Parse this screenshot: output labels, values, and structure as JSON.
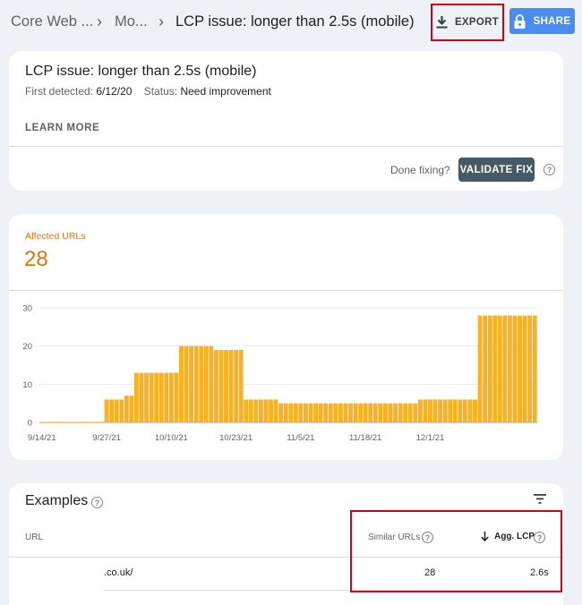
{
  "breadcrumb": {
    "items": [
      "Core Web ...",
      "Mo...",
      "LCP issue: longer than 2.5s (mobile)"
    ]
  },
  "header": {
    "export_label": "EXPORT",
    "share_label": "SHARE",
    "export_icon": "download-icon",
    "share_icon": "lock-icon"
  },
  "issue": {
    "title": "LCP issue: longer than 2.5s (mobile)",
    "first_detected_label": "First detected:",
    "first_detected_value": "6/12/20",
    "status_label": "Status:",
    "status_value": "Need improvement",
    "learn_more": "LEARN MORE",
    "done_fixing": "Done fixing?",
    "validate_fix": "VALIDATE FIX"
  },
  "affected": {
    "label": "Affected URLs",
    "count": "28"
  },
  "chart_data": {
    "type": "bar",
    "series": [
      {
        "values": [
          0,
          0,
          0,
          0,
          0,
          0,
          0,
          0,
          0,
          0,
          0,
          0,
          0,
          6,
          6,
          6,
          6,
          7,
          7,
          13,
          13,
          13,
          13,
          13,
          13,
          13,
          13,
          13,
          20,
          20,
          20,
          20,
          20,
          20,
          20,
          19,
          19,
          19,
          19,
          19,
          19,
          6,
          6,
          6,
          6,
          6,
          6,
          6,
          5,
          5,
          5,
          5,
          5,
          5,
          5,
          5,
          5,
          5,
          5,
          5,
          5,
          5,
          5,
          5,
          5,
          5,
          5,
          5,
          5,
          5,
          5,
          5,
          5,
          5,
          5,
          5,
          6,
          6,
          6,
          6,
          6,
          6,
          6,
          6,
          6,
          6,
          6,
          6,
          28,
          28,
          28,
          28,
          28,
          28,
          28,
          28,
          28,
          28,
          28,
          28
        ]
      }
    ],
    "x_tick_labels": [
      "9/14/21",
      "9/27/21",
      "10/10/21",
      "10/23/21",
      "11/5/21",
      "11/18/21",
      "12/1/21"
    ],
    "y_ticks": [
      0,
      10,
      20,
      30
    ],
    "ylim": [
      0,
      30
    ],
    "color": "#f9b122",
    "grid": true
  },
  "examples": {
    "title": "Examples",
    "col_url": "URL",
    "col_similar": "Similar URLs",
    "col_lcp": "Agg. LCP",
    "rows": [
      {
        "url": ".co.uk/",
        "similar": "28",
        "lcp": "2.6s"
      }
    ]
  },
  "colors": {
    "accent_orange": "#e8710a",
    "share_blue": "#4a8cf0",
    "validate_gray": "#455a64",
    "highlight_red": "#d0021b"
  }
}
